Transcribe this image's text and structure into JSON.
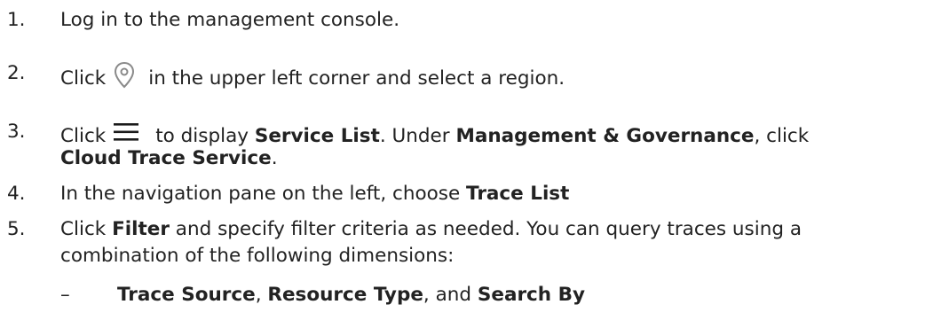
{
  "steps": [
    {
      "num": "1.",
      "text": "Log in to the management console."
    },
    {
      "num": "2.",
      "pre": "Click",
      "icon": "location-pin-icon",
      "post": "in the upper left corner and select a region."
    },
    {
      "num": "3.",
      "pre": "Click",
      "icon": "menu-icon",
      "t1": "to display ",
      "b1": "Service List",
      "t2": ". Under ",
      "b2": "Management & Governance",
      "t3": ", click",
      "b3": "Cloud Trace Service",
      "t4": "."
    },
    {
      "num": "4.",
      "t1": "In the navigation pane on the left, choose ",
      "b1": "Trace List"
    },
    {
      "num": "5.",
      "pre": "Click ",
      "b1": "Filter",
      "t1": " and specify filter criteria as needed. You can query traces using a",
      "t2": "combination of the following dimensions:"
    }
  ],
  "substeps": [
    {
      "dash": "–",
      "b1": "Trace Source",
      "t1": ", ",
      "b2": "Resource Type",
      "t2": ", and ",
      "b3": "Search By"
    }
  ],
  "colors": {
    "text": "#222222",
    "icon": "#8a8a8a"
  }
}
